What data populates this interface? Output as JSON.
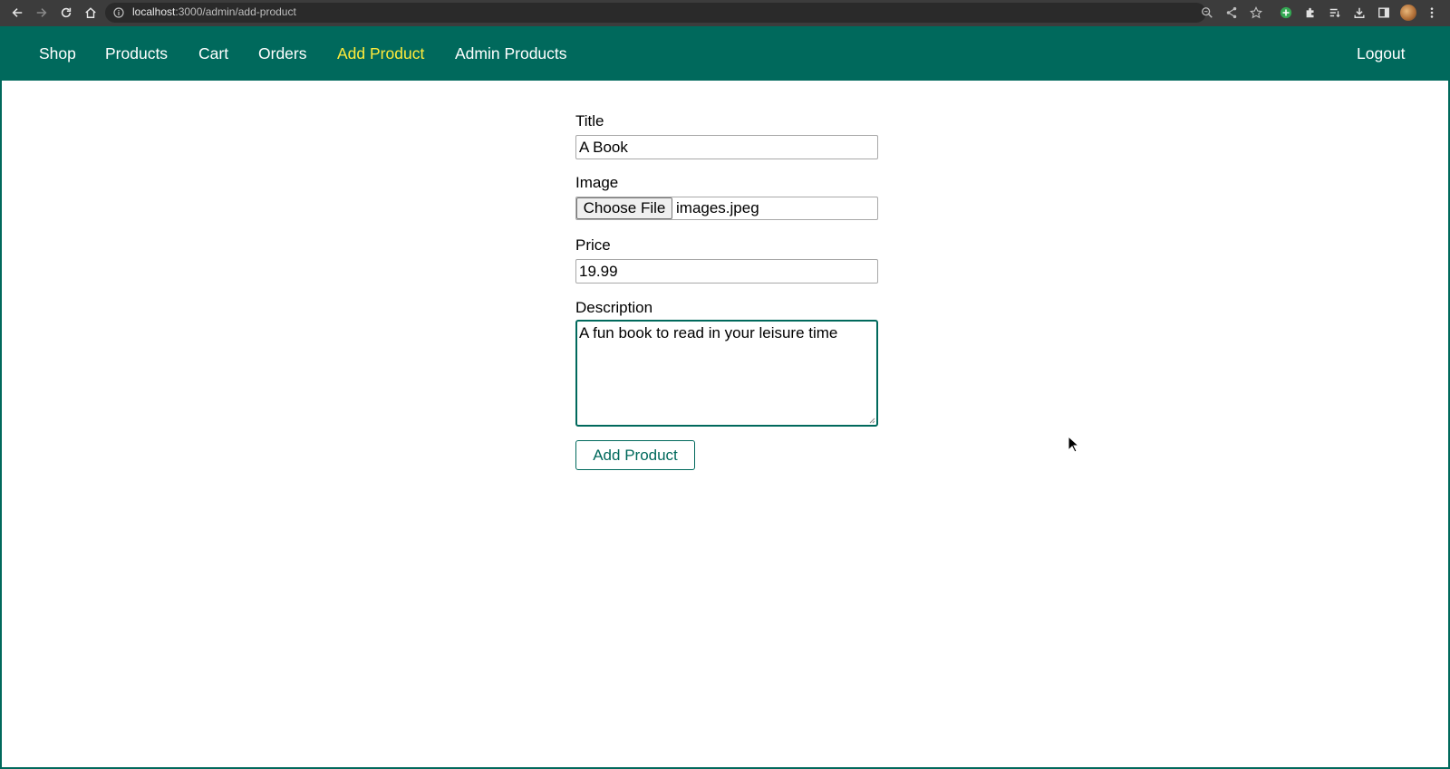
{
  "browser": {
    "url_host": "localhost",
    "url_rest": ":3000/admin/add-product",
    "icons": [
      "back-icon",
      "forward-icon",
      "reload-icon",
      "home-icon",
      "info-icon",
      "zoom-icon",
      "share-icon",
      "star-icon",
      "extension-add-icon",
      "puzzle-icon",
      "reading-list-icon",
      "download-icon",
      "side-panel-icon",
      "profile-avatar",
      "kebab-menu-icon"
    ]
  },
  "nav": {
    "items": [
      {
        "label": "Shop"
      },
      {
        "label": "Products"
      },
      {
        "label": "Cart"
      },
      {
        "label": "Orders"
      },
      {
        "label": "Add Product",
        "active": true
      },
      {
        "label": "Admin Products"
      }
    ],
    "logout": "Logout",
    "active_color": "#ffeb3b"
  },
  "form": {
    "title_label": "Title",
    "title_value": "A Book",
    "image_label": "Image",
    "file_button": "Choose File",
    "file_name": "images.jpeg",
    "price_label": "Price",
    "price_value": "19.99",
    "description_label": "Description",
    "description_value": "A fun book to read in your leisure time",
    "submit_label": "Add Product"
  },
  "colors": {
    "primary": "#00695c",
    "accent": "#ffeb3b"
  }
}
